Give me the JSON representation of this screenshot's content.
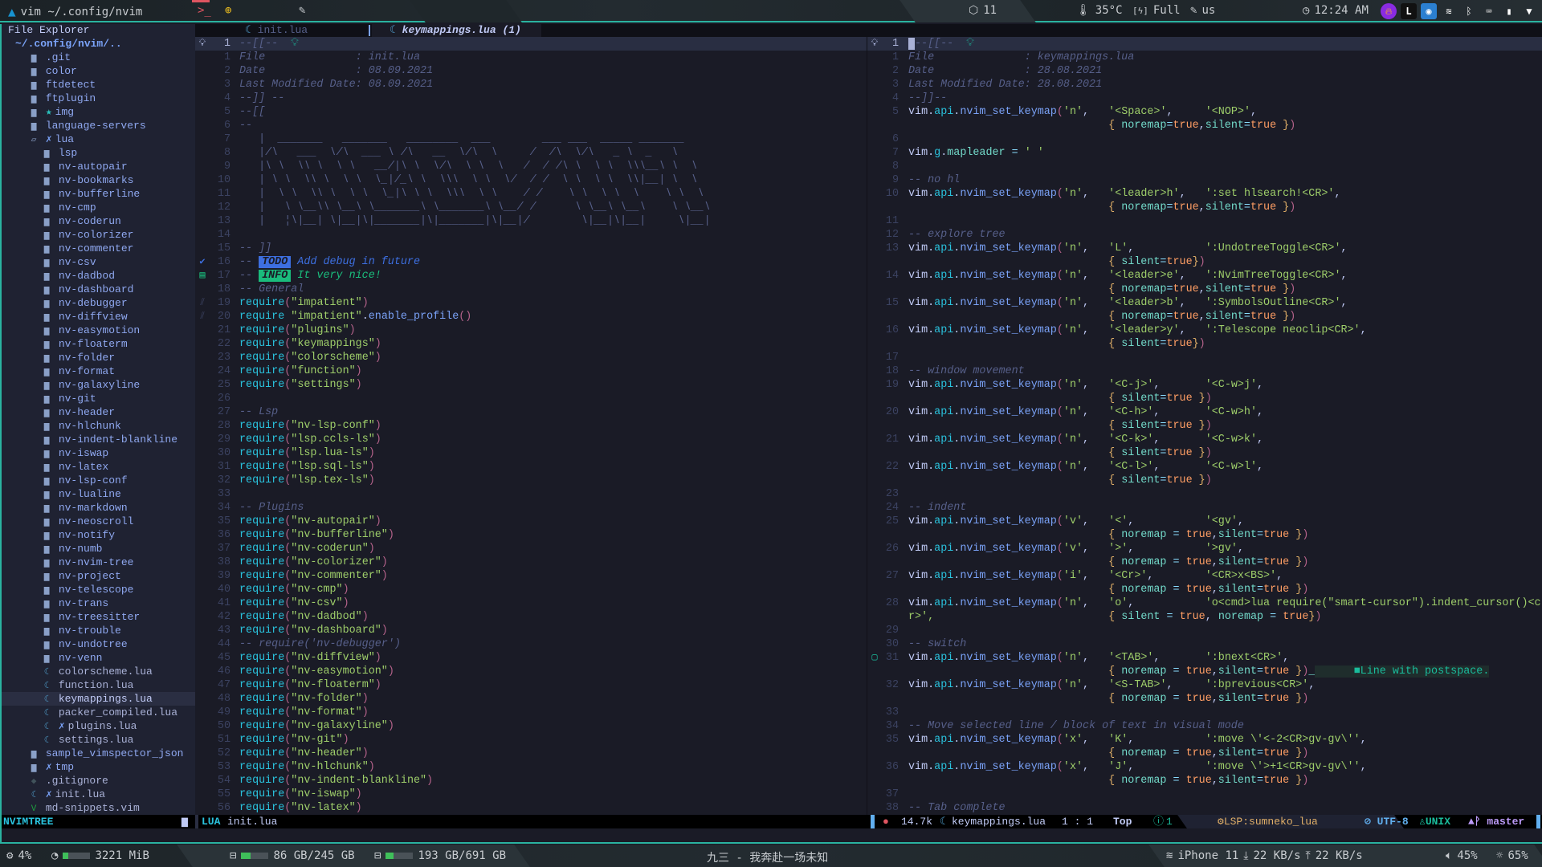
{
  "topbar": {
    "title": "vim ~/.config/nvim",
    "updates": "11",
    "temp": "35°C",
    "battery": "Full",
    "layout": "us",
    "clock": "12:24 AM"
  },
  "bottombar": {
    "cpu": "4%",
    "mem": "3221 MiB",
    "mem_fill": 0.2,
    "disk1": "86 GB/245 GB",
    "disk1_fill": 0.35,
    "disk2": "193 GB/691 GB",
    "disk2_fill": 0.28,
    "song": "九三 - 我奔赴一场未知",
    "wifi": "iPhone 11",
    "down": "22 KB/s",
    "up": "22 KB/s",
    "volume": "45%",
    "brightness": "65%"
  },
  "tree": {
    "title": "File Explorer",
    "items": [
      {
        "d": 0,
        "i": "root",
        "n": "~/.config/nvim/.."
      },
      {
        "d": 1,
        "i": "folder",
        "n": ".git"
      },
      {
        "d": 1,
        "i": "folder",
        "n": "color"
      },
      {
        "d": 1,
        "i": "folder",
        "n": "ftdetect"
      },
      {
        "d": 1,
        "i": "folder",
        "n": "ftplugin"
      },
      {
        "d": 1,
        "i": "folder",
        "n": "img",
        "m": "★"
      },
      {
        "d": 1,
        "i": "folder",
        "n": "language-servers"
      },
      {
        "d": 1,
        "i": "folder-open",
        "n": "lua",
        "m": "✗"
      },
      {
        "d": 2,
        "i": "folder",
        "n": "lsp"
      },
      {
        "d": 2,
        "i": "folder",
        "n": "nv-autopair"
      },
      {
        "d": 2,
        "i": "folder",
        "n": "nv-bookmarks"
      },
      {
        "d": 2,
        "i": "folder",
        "n": "nv-bufferline"
      },
      {
        "d": 2,
        "i": "folder",
        "n": "nv-cmp"
      },
      {
        "d": 2,
        "i": "folder",
        "n": "nv-coderun"
      },
      {
        "d": 2,
        "i": "folder",
        "n": "nv-colorizer"
      },
      {
        "d": 2,
        "i": "folder",
        "n": "nv-commenter"
      },
      {
        "d": 2,
        "i": "folder",
        "n": "nv-csv"
      },
      {
        "d": 2,
        "i": "folder",
        "n": "nv-dadbod"
      },
      {
        "d": 2,
        "i": "folder",
        "n": "nv-dashboard"
      },
      {
        "d": 2,
        "i": "folder",
        "n": "nv-debugger"
      },
      {
        "d": 2,
        "i": "folder",
        "n": "nv-diffview"
      },
      {
        "d": 2,
        "i": "folder",
        "n": "nv-easymotion"
      },
      {
        "d": 2,
        "i": "folder",
        "n": "nv-floaterm"
      },
      {
        "d": 2,
        "i": "folder",
        "n": "nv-folder"
      },
      {
        "d": 2,
        "i": "folder",
        "n": "nv-format"
      },
      {
        "d": 2,
        "i": "folder",
        "n": "nv-galaxyline"
      },
      {
        "d": 2,
        "i": "folder",
        "n": "nv-git"
      },
      {
        "d": 2,
        "i": "folder",
        "n": "nv-header"
      },
      {
        "d": 2,
        "i": "folder",
        "n": "nv-hlchunk"
      },
      {
        "d": 2,
        "i": "folder",
        "n": "nv-indent-blankline"
      },
      {
        "d": 2,
        "i": "folder",
        "n": "nv-iswap"
      },
      {
        "d": 2,
        "i": "folder",
        "n": "nv-latex"
      },
      {
        "d": 2,
        "i": "folder",
        "n": "nv-lsp-conf"
      },
      {
        "d": 2,
        "i": "folder",
        "n": "nv-lualine"
      },
      {
        "d": 2,
        "i": "folder",
        "n": "nv-markdown"
      },
      {
        "d": 2,
        "i": "folder",
        "n": "nv-neoscroll"
      },
      {
        "d": 2,
        "i": "folder",
        "n": "nv-notify"
      },
      {
        "d": 2,
        "i": "folder",
        "n": "nv-numb"
      },
      {
        "d": 2,
        "i": "folder",
        "n": "nv-nvim-tree"
      },
      {
        "d": 2,
        "i": "folder",
        "n": "nv-project"
      },
      {
        "d": 2,
        "i": "folder",
        "n": "nv-telescope"
      },
      {
        "d": 2,
        "i": "folder",
        "n": "nv-trans"
      },
      {
        "d": 2,
        "i": "folder",
        "n": "nv-treesitter"
      },
      {
        "d": 2,
        "i": "folder",
        "n": "nv-trouble"
      },
      {
        "d": 2,
        "i": "folder",
        "n": "nv-undotree"
      },
      {
        "d": 2,
        "i": "folder",
        "n": "nv-venn"
      },
      {
        "d": 2,
        "i": "lua",
        "n": "colorscheme.lua"
      },
      {
        "d": 2,
        "i": "lua",
        "n": "function.lua"
      },
      {
        "d": 2,
        "i": "lua",
        "n": "keymappings.lua",
        "sel": true
      },
      {
        "d": 2,
        "i": "lua",
        "n": "packer_compiled.lua"
      },
      {
        "d": 2,
        "i": "lua",
        "n": "plugins.lua",
        "m": "✗"
      },
      {
        "d": 2,
        "i": "lua",
        "n": "settings.lua"
      },
      {
        "d": 1,
        "i": "folder",
        "n": "sample_vimspector_json"
      },
      {
        "d": 1,
        "i": "folder",
        "n": "tmp",
        "m": "✗"
      },
      {
        "d": 1,
        "i": "git",
        "n": ".gitignore"
      },
      {
        "d": 1,
        "i": "lua",
        "n": "init.lua",
        "m": "✗"
      },
      {
        "d": 1,
        "i": "vim",
        "n": "md-snippets.vim"
      }
    ]
  },
  "tabs": [
    {
      "label": "init.lua",
      "active": false
    },
    {
      "label": "keymappings.lua (1)",
      "active": true
    }
  ],
  "left": {
    "lines": [
      {
        "n": "1",
        "t": "--[[--",
        "cur": true
      },
      {
        "n": "1",
        "t": "File              : init.lua",
        "k": "c"
      },
      {
        "n": "2",
        "t": "Date              : 08.09.2021",
        "k": "c"
      },
      {
        "n": "3",
        "t": "Last Modified Date: 08.09.2021",
        "k": "c"
      },
      {
        "n": "4",
        "t": "--]] --",
        "k": "c"
      },
      {
        "n": "5",
        "t": "--[[",
        "k": "c"
      },
      {
        "n": "6",
        "t": "--",
        "k": "c"
      },
      {
        "n": "7",
        "t": "   |  _______   _______   ________  ___        ___ ___  _____ _______",
        "k": "c"
      },
      {
        "n": "8",
        "t": "   |/\\   ___  \\/\\  ___ \\ /\\   __  \\/\\  \\     /  /\\  \\/\\   _ \\  _   \\",
        "k": "c"
      },
      {
        "n": "9",
        "t": "   |\\ \\  \\\\ \\  \\ \\   __/|\\ \\  \\/\\  \\ \\  \\   /  / /\\ \\  \\ \\  \\\\\\__\\ \\  \\",
        "k": "c"
      },
      {
        "n": "10",
        "t": "   | \\ \\  \\\\ \\  \\ \\  \\_|/_\\ \\  \\\\\\  \\ \\  \\/  / /  \\ \\  \\ \\  \\\\|__| \\  \\",
        "k": "c"
      },
      {
        "n": "11",
        "t": "   |  \\ \\  \\\\ \\  \\ \\  \\_|\\ \\ \\  \\\\\\  \\ \\    / /    \\ \\  \\ \\  \\    \\ \\  \\",
        "k": "c"
      },
      {
        "n": "12",
        "t": "   |   \\ \\__\\\\ \\__\\ \\_______\\ \\_______\\ \\__/ /      \\ \\__\\ \\__\\    \\ \\__\\",
        "k": "c"
      },
      {
        "n": "13",
        "t": "   |   ¦\\|__| \\|__|\\|_______|\\|_______|\\|__|/        \\|__|\\|__|     \\|__|",
        "k": "c"
      },
      {
        "n": "14",
        "t": ""
      },
      {
        "n": "15",
        "t": "-- ]]",
        "k": "c"
      },
      {
        "n": "16",
        "tag": "TODO",
        "t": "Add debug in future",
        "sign": "check"
      },
      {
        "n": "17",
        "tag": "INFO",
        "t": "It very nice!",
        "sign": "note"
      },
      {
        "n": "18",
        "t": "-- General"
      },
      {
        "n": "19",
        "t": "require(\"impatient\")",
        "sign": "hatch"
      },
      {
        "n": "20",
        "t": "require \"impatient\".enable_profile()",
        "sign": "hatch"
      },
      {
        "n": "21",
        "t": "require(\"plugins\")"
      },
      {
        "n": "22",
        "t": "require(\"keymappings\")"
      },
      {
        "n": "23",
        "t": "require(\"colorscheme\")"
      },
      {
        "n": "24",
        "t": "require(\"function\")"
      },
      {
        "n": "25",
        "t": "require(\"settings\")"
      },
      {
        "n": "26",
        "t": ""
      },
      {
        "n": "27",
        "t": "-- Lsp"
      },
      {
        "n": "28",
        "t": "require(\"nv-lsp-conf\")"
      },
      {
        "n": "29",
        "t": "require(\"lsp.ccls-ls\")"
      },
      {
        "n": "30",
        "t": "require(\"lsp.lua-ls\")"
      },
      {
        "n": "31",
        "t": "require(\"lsp.sql-ls\")"
      },
      {
        "n": "32",
        "t": "require(\"lsp.tex-ls\")"
      },
      {
        "n": "33",
        "t": ""
      },
      {
        "n": "34",
        "t": "-- Plugins"
      },
      {
        "n": "35",
        "t": "require(\"nv-autopair\")"
      },
      {
        "n": "36",
        "t": "require(\"nv-bufferline\")"
      },
      {
        "n": "37",
        "t": "require(\"nv-coderun\")"
      },
      {
        "n": "38",
        "t": "require(\"nv-colorizer\")"
      },
      {
        "n": "39",
        "t": "require(\"nv-commenter\")"
      },
      {
        "n": "40",
        "t": "require(\"nv-cmp\")"
      },
      {
        "n": "41",
        "t": "require(\"nv-csv\")"
      },
      {
        "n": "42",
        "t": "require(\"nv-dadbod\")"
      },
      {
        "n": "43",
        "t": "require(\"nv-dashboard\")"
      },
      {
        "n": "44",
        "t": "-- require('nv-debugger')"
      },
      {
        "n": "45",
        "t": "require(\"nv-diffview\")"
      },
      {
        "n": "46",
        "t": "require(\"nv-easymotion\")"
      },
      {
        "n": "47",
        "t": "require(\"nv-floaterm\")"
      },
      {
        "n": "48",
        "t": "require(\"nv-folder\")"
      },
      {
        "n": "49",
        "t": "require(\"nv-format\")"
      },
      {
        "n": "50",
        "t": "require(\"nv-galaxyline\")"
      },
      {
        "n": "51",
        "t": "require(\"nv-git\")"
      },
      {
        "n": "52",
        "t": "require(\"nv-header\")"
      },
      {
        "n": "53",
        "t": "require(\"nv-hlchunk\")"
      },
      {
        "n": "54",
        "t": "require(\"nv-indent-blankline\")"
      },
      {
        "n": "55",
        "t": "require(\"nv-iswap\")"
      },
      {
        "n": "56",
        "t": "require(\"nv-latex\")"
      }
    ]
  },
  "right": {
    "lines": [
      {
        "n": "1",
        "t": "--[[--",
        "cur": true
      },
      {
        "n": "1",
        "t": "File              : keymappings.lua",
        "k": "c"
      },
      {
        "n": "2",
        "t": "Date              : 28.08.2021",
        "k": "c"
      },
      {
        "n": "3",
        "t": "Last Modified Date: 28.08.2021",
        "k": "c"
      },
      {
        "n": "4",
        "t": "--]]--",
        "k": "c"
      },
      {
        "n": "5",
        "t": "vim.api.nvim_set_keymap('n',   '<Space>',     '<NOP>',"
      },
      {
        "n": "",
        "t": "                               { noremap=true,silent=true })"
      },
      {
        "n": "6",
        "t": ""
      },
      {
        "n": "7",
        "t": "vim.g.mapleader = ' '"
      },
      {
        "n": "8",
        "t": ""
      },
      {
        "n": "9",
        "t": "-- no hl"
      },
      {
        "n": "10",
        "t": "vim.api.nvim_set_keymap('n',   '<leader>h',   ':set hlsearch!<CR>',"
      },
      {
        "n": "",
        "t": "                               { noremap=true,silent=true })"
      },
      {
        "n": "11",
        "t": ""
      },
      {
        "n": "12",
        "t": "-- explore tree"
      },
      {
        "n": "13",
        "t": "vim.api.nvim_set_keymap('n',   'L',           ':UndotreeToggle<CR>',"
      },
      {
        "n": "",
        "t": "                               { silent=true})"
      },
      {
        "n": "14",
        "t": "vim.api.nvim_set_keymap('n',   '<leader>e',   ':NvimTreeToggle<CR>',"
      },
      {
        "n": "",
        "t": "                               { noremap=true,silent=true })"
      },
      {
        "n": "15",
        "t": "vim.api.nvim_set_keymap('n',   '<leader>b',   ':SymbolsOutline<CR>',"
      },
      {
        "n": "",
        "t": "                               { noremap=true,silent=true })"
      },
      {
        "n": "16",
        "t": "vim.api.nvim_set_keymap('n',   '<leader>y',   ':Telescope neoclip<CR>',"
      },
      {
        "n": "",
        "t": "                               { silent=true})"
      },
      {
        "n": "17",
        "t": ""
      },
      {
        "n": "18",
        "t": "-- window movement"
      },
      {
        "n": "19",
        "t": "vim.api.nvim_set_keymap('n',   '<C-j>',       '<C-w>j',"
      },
      {
        "n": "",
        "t": "                               { silent=true })"
      },
      {
        "n": "20",
        "t": "vim.api.nvim_set_keymap('n',   '<C-h>',       '<C-w>h',"
      },
      {
        "n": "",
        "t": "                               { silent=true })"
      },
      {
        "n": "21",
        "t": "vim.api.nvim_set_keymap('n',   '<C-k>',       '<C-w>k',"
      },
      {
        "n": "",
        "t": "                               { silent=true })"
      },
      {
        "n": "22",
        "t": "vim.api.nvim_set_keymap('n',   '<C-l>',       '<C-w>l',"
      },
      {
        "n": "",
        "t": "                               { silent=true })"
      },
      {
        "n": "23",
        "t": ""
      },
      {
        "n": "24",
        "t": "-- indent"
      },
      {
        "n": "25",
        "t": "vim.api.nvim_set_keymap('v',   '<',           '<gv',"
      },
      {
        "n": "",
        "t": "                               { noremap = true,silent=true })"
      },
      {
        "n": "26",
        "t": "vim.api.nvim_set_keymap('v',   '>',           '>gv',"
      },
      {
        "n": "",
        "t": "                               { noremap = true,silent=true })"
      },
      {
        "n": "27",
        "t": "vim.api.nvim_set_keymap('i',   '<Cr>',        '<CR>x<BS>',"
      },
      {
        "n": "",
        "t": "                               { noremap = true,silent=true })"
      },
      {
        "n": "28",
        "t": "vim.api.nvim_set_keymap('n',   'o',           'o<cmd>lua require(\"smart-cursor\").indent_cursor()<c"
      },
      {
        "n": "",
        "sp": "r>',",
        "t": "                           { silent = true, noremap = true})"
      },
      {
        "n": "29",
        "t": ""
      },
      {
        "n": "30",
        "t": "-- switch"
      },
      {
        "n": "31",
        "t": "vim.api.nvim_set_keymap('n',   '<TAB>',       ':bnext<CR>',",
        "sign": "comment"
      },
      {
        "n": "",
        "t": "                               { noremap = true,silent=true })_",
        "vt": "Line with postspace."
      },
      {
        "n": "32",
        "t": "vim.api.nvim_set_keymap('n',   '<S-TAB>',     ':bprevious<CR>',"
      },
      {
        "n": "",
        "t": "                               { noremap = true,silent=true })"
      },
      {
        "n": "33",
        "t": ""
      },
      {
        "n": "34",
        "t": "-- Move selected line / block of text in visual mode"
      },
      {
        "n": "35",
        "t": "vim.api.nvim_set_keymap('x',   'K',           ':move \\'<-2<CR>gv-gv\\'',"
      },
      {
        "n": "",
        "t": "                               { noremap = true,silent=true })"
      },
      {
        "n": "36",
        "t": "vim.api.nvim_set_keymap('x',   'J',           ':move \\'>+1<CR>gv-gv\\'',"
      },
      {
        "n": "",
        "t": "                               { noremap = true,silent=true })"
      },
      {
        "n": "37",
        "t": ""
      },
      {
        "n": "38",
        "t": "-- Tab complete"
      }
    ]
  },
  "status": {
    "tree": "NVIMTREE",
    "left_mode": "LUA",
    "left_file": "init.lua",
    "size": "14.7k",
    "file": "keymappings.lua",
    "pos": "1 : 1",
    "scroll": "Top",
    "diag": "1",
    "lsp": "LSP:sumneko_lua",
    "encoding": "UTF-8",
    "format": "UNIX",
    "branch": "master"
  },
  "colors": {
    "accent": "#2ab3a0",
    "todo": "#3d6fe0",
    "info": "#1abc7c"
  }
}
